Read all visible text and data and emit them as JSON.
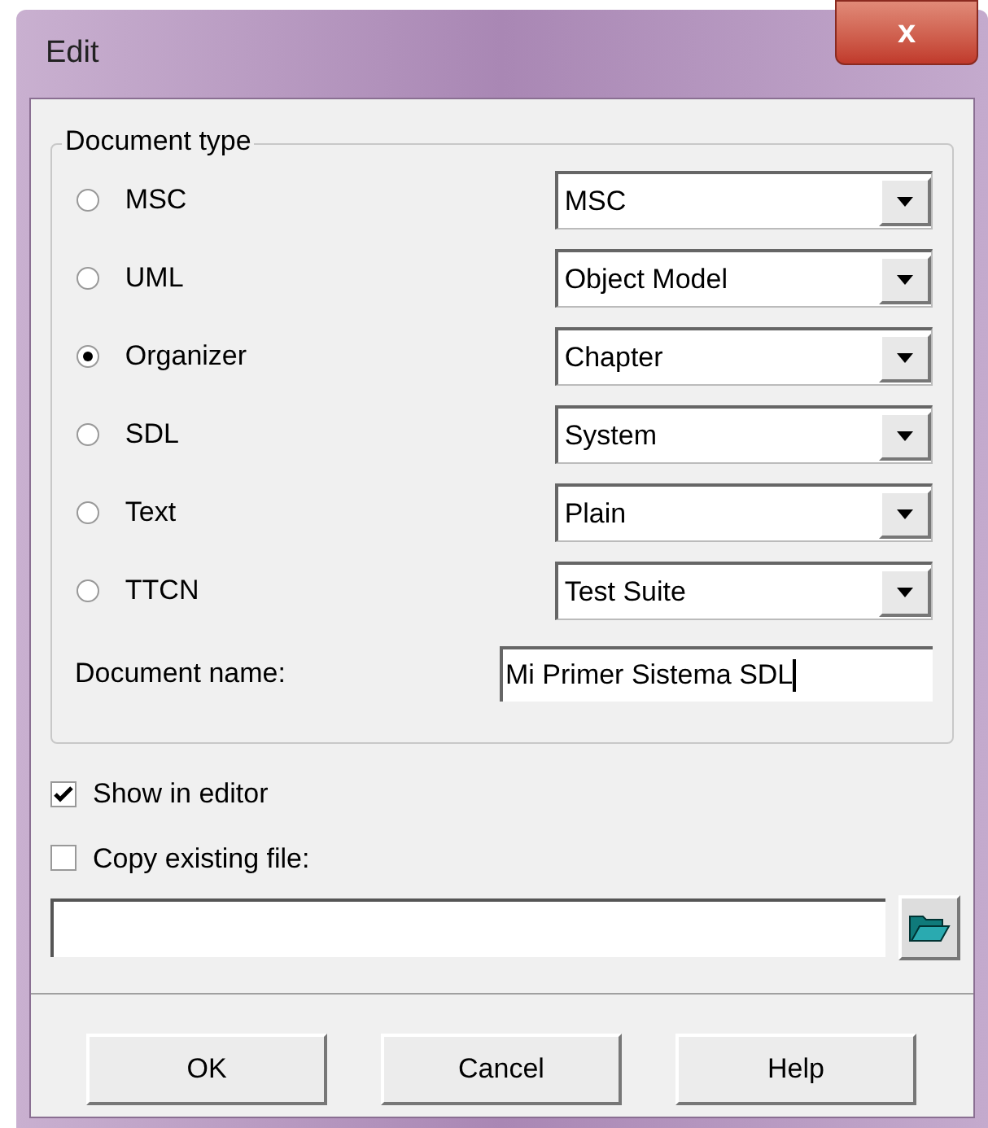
{
  "window": {
    "title": "Edit",
    "close": "x"
  },
  "document_type": {
    "label": "Document type",
    "types": [
      {
        "label": "MSC",
        "selected": false,
        "value": "MSC"
      },
      {
        "label": "UML",
        "selected": false,
        "value": "Object Model"
      },
      {
        "label": "Organizer",
        "selected": true,
        "value": "Chapter"
      },
      {
        "label": "SDL",
        "selected": false,
        "value": "System"
      },
      {
        "label": "Text",
        "selected": false,
        "value": "Plain"
      },
      {
        "label": "TTCN",
        "selected": false,
        "value": "Test Suite"
      }
    ]
  },
  "document_name": {
    "label": "Document name:",
    "value": "Mi Primer Sistema SDL"
  },
  "options": [
    {
      "label": "Show in editor",
      "checked": true
    },
    {
      "label": "Copy existing file:",
      "checked": false
    }
  ],
  "buttons": [
    "OK",
    "Cancel",
    "Help"
  ]
}
